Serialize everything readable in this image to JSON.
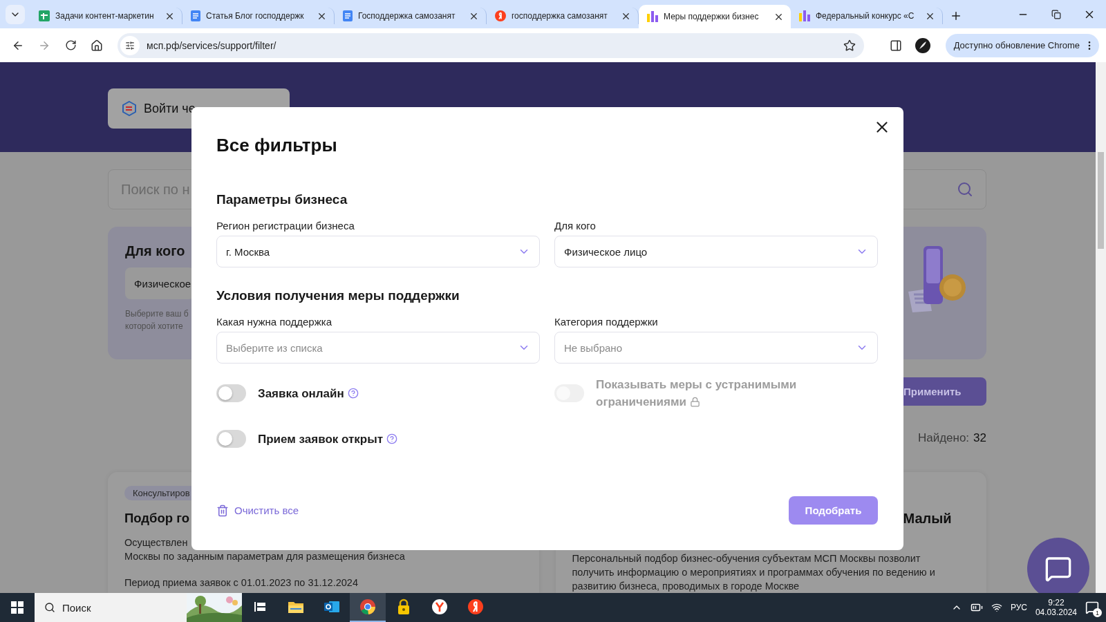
{
  "browser": {
    "tabs": [
      {
        "title": "Задачи контент-маркетин",
        "kind": "sheet",
        "selected": false
      },
      {
        "title": "Статья Блог господдержк",
        "kind": "doc",
        "selected": false
      },
      {
        "title": "Господдержка самозанят",
        "kind": "doc",
        "selected": false
      },
      {
        "title": "господдержка самозанят",
        "kind": "search",
        "selected": false
      },
      {
        "title": "Меры поддержки бизнес",
        "kind": "bars",
        "selected": true
      },
      {
        "title": "Федеральный конкурс «С",
        "kind": "bars",
        "selected": false
      }
    ],
    "address": "мсп.рф/services/support/filter/",
    "update_button": "Доступно обновление Chrome"
  },
  "page": {
    "login_button": "Войти че",
    "search": {
      "placeholder": "Поиск по н"
    },
    "filter_card": {
      "title": "Для кого",
      "select": "Физическое",
      "hint": [
        "Выберите ваш б",
        "которой хотите"
      ]
    },
    "apply_button": "Применить",
    "found": {
      "label": "Найдено:",
      "count": "32"
    },
    "cards": [
      {
        "tag": "Консультиров",
        "title": "Подбор го",
        "lines": [
          "Осуществлен",
          "Москвы по заданным параметрам для размещения бизнеса",
          "Период приема заявок с 01.01.2023 по 31.12.2024"
        ]
      },
      {
        "title": "Малый",
        "lines": [
          "Персональный подбор бизнес-обучения субъектам МСП Москвы позволит",
          "получить информацию о мероприятиях и программах обучения по ведению и",
          "развитию бизнеса, проводимых в городе Москве"
        ]
      }
    ]
  },
  "modal": {
    "title": "Все фильтры",
    "sections": [
      {
        "heading": "Параметры бизнеса",
        "fields": [
          {
            "label": "Регион регистрации бизнеса",
            "value": "г. Москва"
          },
          {
            "label": "Для кого",
            "value": "Физическое лицо"
          }
        ]
      },
      {
        "heading": "Условия получения меры поддержки",
        "fields": [
          {
            "label": "Какая нужна поддержка",
            "placeholder": "Выберите из списка"
          },
          {
            "label": "Категория поддержки",
            "placeholder": "Не выбрано"
          }
        ]
      }
    ],
    "toggles": [
      {
        "label": "Заявка онлайн",
        "on": false,
        "disabled": false,
        "kind": "help"
      },
      {
        "label": "Показывать меры с устранимыми ограничениями",
        "on": false,
        "disabled": true,
        "kind": "lock"
      },
      {
        "label": "Прием заявок открыт",
        "on": false,
        "disabled": false,
        "kind": "help"
      }
    ],
    "clear_button": "Очистить все",
    "submit_button": "Подобрать"
  },
  "taskbar": {
    "search": "Поиск",
    "apps": [
      {
        "kind": "tasks",
        "selected": false
      },
      {
        "kind": "folder",
        "selected": false
      },
      {
        "kind": "mail",
        "selected": false
      },
      {
        "kind": "browser",
        "selected": true
      },
      {
        "kind": "lock",
        "selected": false
      },
      {
        "kind": "ybrowser",
        "selected": false
      },
      {
        "kind": "ysearch",
        "selected": false
      }
    ],
    "language": "РУС",
    "time": "9:22",
    "date": "04.03.2024",
    "notifications": "1"
  }
}
